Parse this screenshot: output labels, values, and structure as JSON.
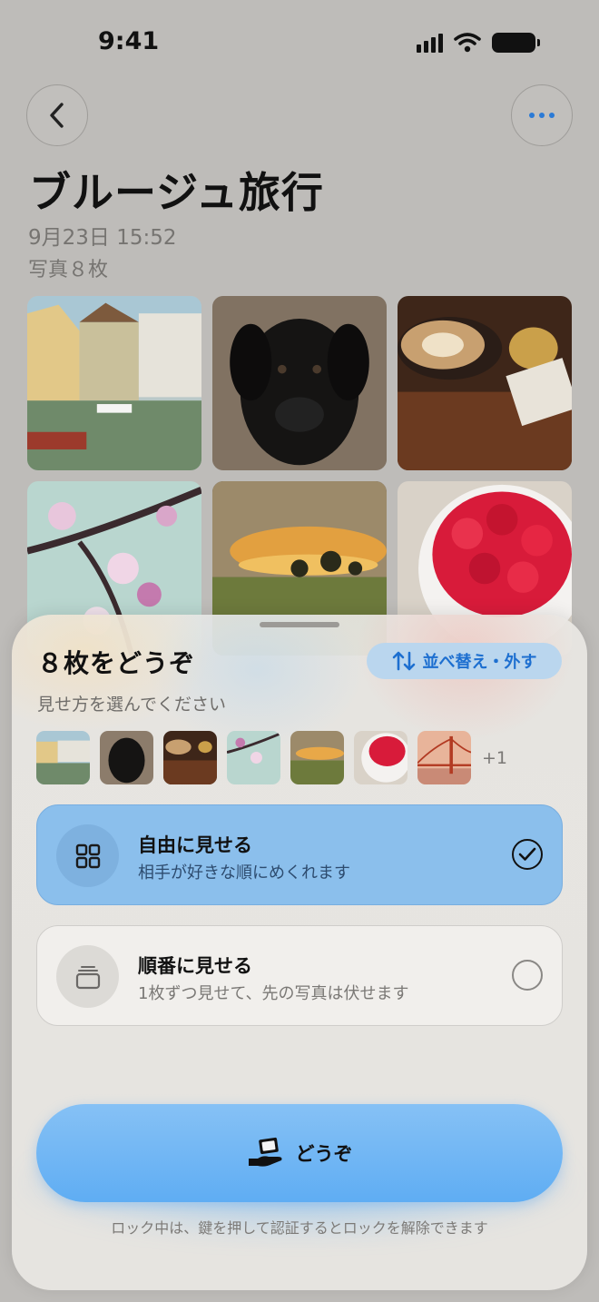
{
  "status_bar": {
    "time": "9:41"
  },
  "album": {
    "title": "ブルージュ旅行",
    "date": "9月23日 15:52",
    "count": "写真８枚",
    "photos": [
      "canal",
      "dog",
      "coffee",
      "blossom",
      "sunset",
      "raspberries"
    ]
  },
  "sheet": {
    "title": "８枚をどうぞ",
    "subtitle": "見せ方を選んでください",
    "reorder_label": "並べ替え・外す",
    "thumbnails": [
      "canal",
      "dog",
      "coffee",
      "blossom",
      "sunset",
      "raspberries",
      "bridge"
    ],
    "more_count": "+1",
    "options": [
      {
        "title": "自由に見せる",
        "description": "相手が好きな順にめくれます",
        "selected": true,
        "icon": "grid-icon"
      },
      {
        "title": "順番に見せる",
        "description": "1枚ずつ見せて、先の写真は伏せます",
        "selected": false,
        "icon": "card-stack-icon"
      }
    ],
    "give_label": "どうぞ",
    "footnote": "ロック中は、鍵を押して認証するとロックを解除できます"
  },
  "colors": {
    "accent": "#1d6fd0",
    "selected_option": "#8bbfec",
    "primary_button": "#5fadf3"
  }
}
